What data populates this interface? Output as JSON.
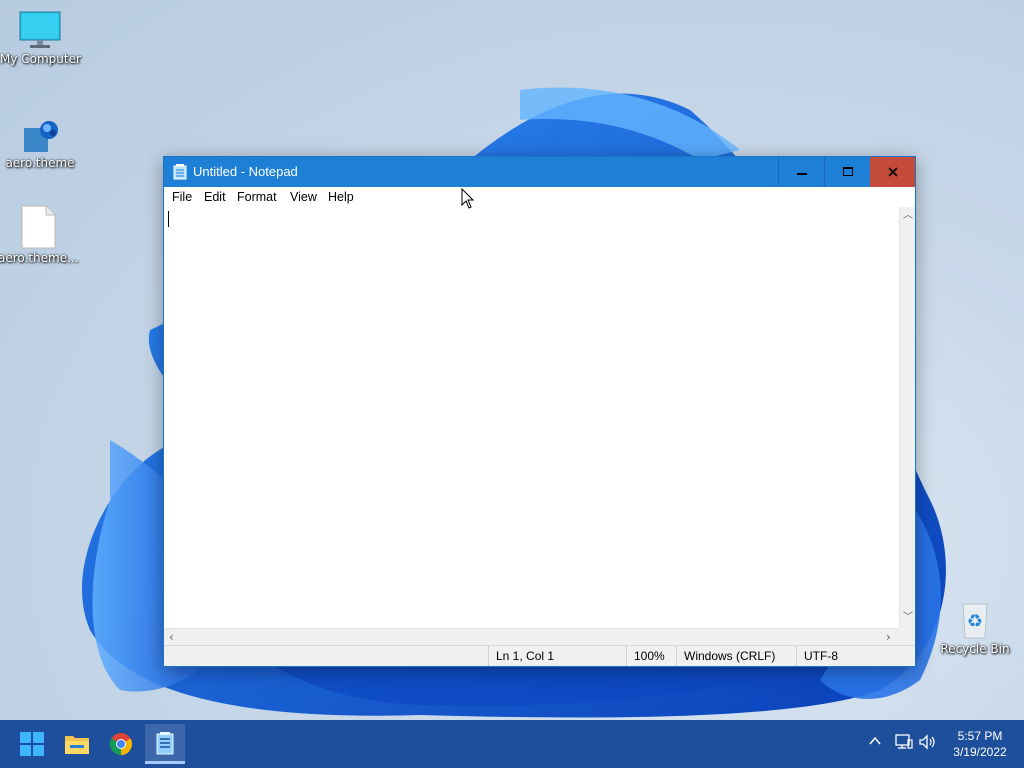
{
  "desktop": {
    "icons": [
      {
        "label": "My Computer"
      },
      {
        "label": "aero.theme"
      },
      {
        "label": "aero.theme..."
      },
      {
        "label": "Recycle Bin"
      }
    ]
  },
  "notepad": {
    "title": "Untitled - Notepad",
    "menu": [
      "File",
      "Edit",
      "Format",
      "View",
      "Help"
    ],
    "content": "",
    "status": {
      "position": "Ln 1, Col 1",
      "zoom": "100%",
      "line_ending": "Windows (CRLF)",
      "encoding": "UTF-8"
    }
  },
  "taskbar": {
    "apps": [
      "start-icon",
      "file-explorer-icon",
      "chrome-icon",
      "notepad-icon"
    ],
    "clock": {
      "time": "5:57 PM",
      "date": "3/19/2022"
    }
  },
  "colors": {
    "titlebar": "#1e7fd6",
    "close": "#c44a3a",
    "taskbar": "#1d4f9c"
  }
}
